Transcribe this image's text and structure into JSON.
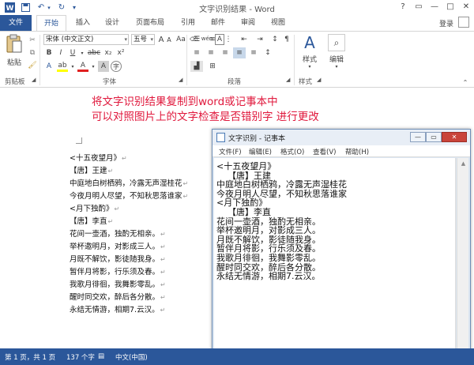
{
  "titlebar": {
    "title": "文字识别结果 - Word",
    "help": "?",
    "ribbon_display": "▭",
    "minimize": "—",
    "maximize": "□",
    "close": "✕"
  },
  "tabs": {
    "file": "文件",
    "home": "开始",
    "insert": "插入",
    "design": "设计",
    "layout": "页面布局",
    "references": "引用",
    "mailings": "邮件",
    "review": "审阅",
    "view": "视图",
    "login": "登录"
  },
  "ribbon": {
    "paste_label": "粘贴",
    "clipboard_group": "剪贴板",
    "font_group": "字体",
    "paragraph_group": "段落",
    "styles_group": "样式",
    "styles_label": "样式",
    "edit_label": "编辑",
    "font_name": "宋体 (中文正文)",
    "font_size": "五号",
    "grow_font": "A",
    "shrink_font": "A",
    "change_case": "Aa",
    "phonetic": "wén",
    "char_border": "A",
    "bold": "B",
    "italic": "I",
    "underline": "U",
    "strike": "abc",
    "subscript": "x₂",
    "superscript": "x²",
    "char_shading": "A",
    "enclosed": "字"
  },
  "document": {
    "note_line1": "将文字识别结果复制到word或记事本中",
    "note_line2": "可以对照图片上的文字检查是否错别字 进行更改",
    "lines": [
      "<十五夜望月》",
      "【唐】王建",
      "中庭地白树栖鸦，冷露无声湿桂花",
      "今夜月明人尽望，不知秋思落谁家",
      "<月下独酌》",
      "【唐】李直",
      "花间一壶酒，独酌无相亲。",
      "举杯邀明月，对影成三人。",
      "月既不解饮，影徒随我身。",
      "暂伴月将影，行乐须及春。",
      "我歌月徘徊，我舞影零乱。",
      "醒时同交欢，醉后各分散。",
      "永结无情游，相期7.云汉。"
    ]
  },
  "notepad": {
    "title": "文字识别 - 记事本",
    "minimize": "—",
    "maximize": "▭",
    "close": "✕",
    "menu": [
      "文件(F)",
      "编辑(E)",
      "格式(O)",
      "查看(V)",
      "帮助(H)"
    ],
    "lines": [
      "<十五夜望月》",
      "    【唐】王建",
      "中庭地白树栖鸦，冷露无声湿桂花",
      "今夜月明人尽望，不知秋思落谁家",
      "<月下独酌》",
      "    【唐】李直",
      "花间一壶酒，独酌无相亲。",
      "举杯邀明月，对影成三人。",
      "月既不解饮，影徒随我身。",
      "暂伴月将影，行乐须及春。",
      "我歌月徘徊，我舞影零乱。",
      "醒时同交欢，醉后各分散。",
      "永结无情游，相期7.云汉。"
    ]
  },
  "status": {
    "page": "第 1 页，共 1 页",
    "words": "137 个字",
    "language": "中文(中国)"
  }
}
